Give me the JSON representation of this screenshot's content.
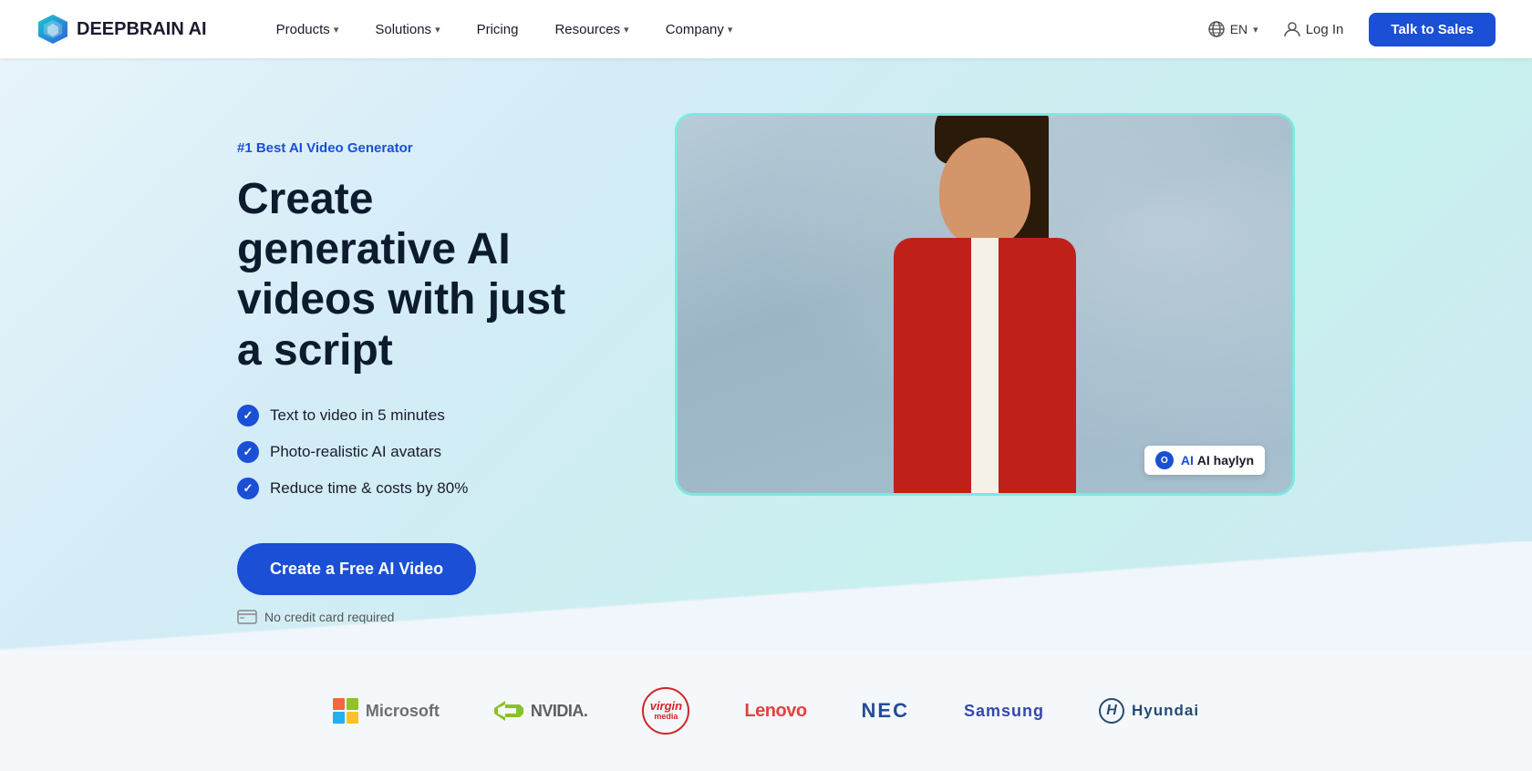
{
  "brand": {
    "name": "DEEPBRAIN AI",
    "logo_icon": "cube-icon"
  },
  "nav": {
    "links": [
      {
        "label": "Products",
        "has_dropdown": true
      },
      {
        "label": "Solutions",
        "has_dropdown": true
      },
      {
        "label": "Pricing",
        "has_dropdown": false
      },
      {
        "label": "Resources",
        "has_dropdown": true
      },
      {
        "label": "Company",
        "has_dropdown": true
      }
    ],
    "lang": "EN",
    "login_label": "Log In",
    "cta_label": "Talk to Sales"
  },
  "hero": {
    "badge": "#1 Best AI Video Generator",
    "title_line1": "Create generative AI",
    "title_line2": "videos with just a script",
    "features": [
      "Text to video in 5 minutes",
      "Photo-realistic AI avatars",
      "Reduce time & costs by 80%"
    ],
    "cta_label": "Create a Free AI Video",
    "no_card_text": "No credit card required",
    "avatar_name": "AI haylyn"
  },
  "logos": [
    {
      "name": "Microsoft",
      "type": "microsoft"
    },
    {
      "name": "NVIDIA",
      "type": "nvidia"
    },
    {
      "name": "Virgin Media",
      "type": "virgin"
    },
    {
      "name": "Lenovo",
      "type": "lenovo"
    },
    {
      "name": "NEC",
      "type": "nec"
    },
    {
      "name": "Samsung",
      "type": "samsung"
    },
    {
      "name": "Hyundai",
      "type": "hyundai"
    }
  ]
}
